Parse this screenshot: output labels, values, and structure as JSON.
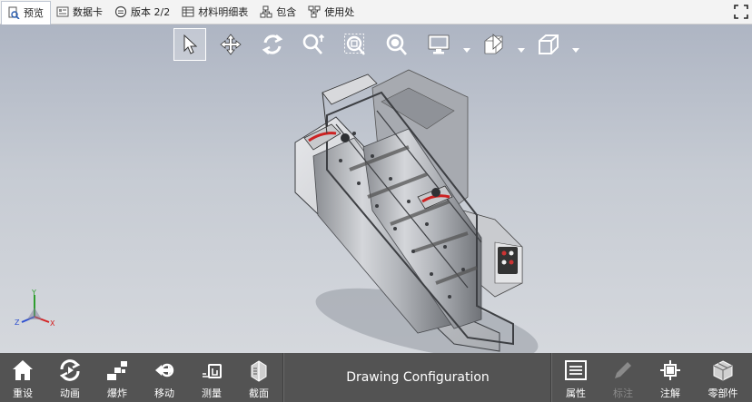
{
  "tabs": [
    {
      "label": "预览",
      "icon": "preview-icon",
      "active": true
    },
    {
      "label": "数据卡",
      "icon": "datacard-icon",
      "active": false
    },
    {
      "label": "版本 2/2",
      "icon": "version-icon",
      "active": false
    },
    {
      "label": "材料明细表",
      "icon": "bom-table-icon",
      "active": false
    },
    {
      "label": "包含",
      "icon": "contains-icon",
      "active": false
    },
    {
      "label": "使用处",
      "icon": "where-used-icon",
      "active": false
    }
  ],
  "viewport_toolbar": [
    "select-icon",
    "pan-icon",
    "rotate-icon",
    "zoom-icon",
    "zoom-area-icon",
    "zoom-fit-icon",
    "display-style-icon",
    "section-view-icon",
    "view-orientation-icon"
  ],
  "triad": {
    "x": "X",
    "y": "Y",
    "z": "Z"
  },
  "bottom_left": [
    {
      "label": "重设",
      "icon": "home-icon"
    },
    {
      "label": "动画",
      "icon": "animation-icon"
    },
    {
      "label": "爆炸",
      "icon": "explode-icon"
    },
    {
      "label": "移动",
      "icon": "move-icon"
    },
    {
      "label": "测量",
      "icon": "measure-icon"
    },
    {
      "label": "截面",
      "icon": "section-icon"
    }
  ],
  "configuration": "Drawing Configuration",
  "bottom_right": [
    {
      "label": "属性",
      "icon": "properties-icon",
      "enabled": true
    },
    {
      "label": "标注",
      "icon": "markup-pen-icon",
      "enabled": false
    },
    {
      "label": "注解",
      "icon": "annotation-icon",
      "enabled": true
    },
    {
      "label": "零部件",
      "icon": "components-icon",
      "enabled": true
    }
  ],
  "colors": {
    "toolbar_bg": "#f3f3f3",
    "bottom_bar": "#535353",
    "viewport_top": "#aeb5c3",
    "viewport_bottom": "#d5d8dd"
  }
}
